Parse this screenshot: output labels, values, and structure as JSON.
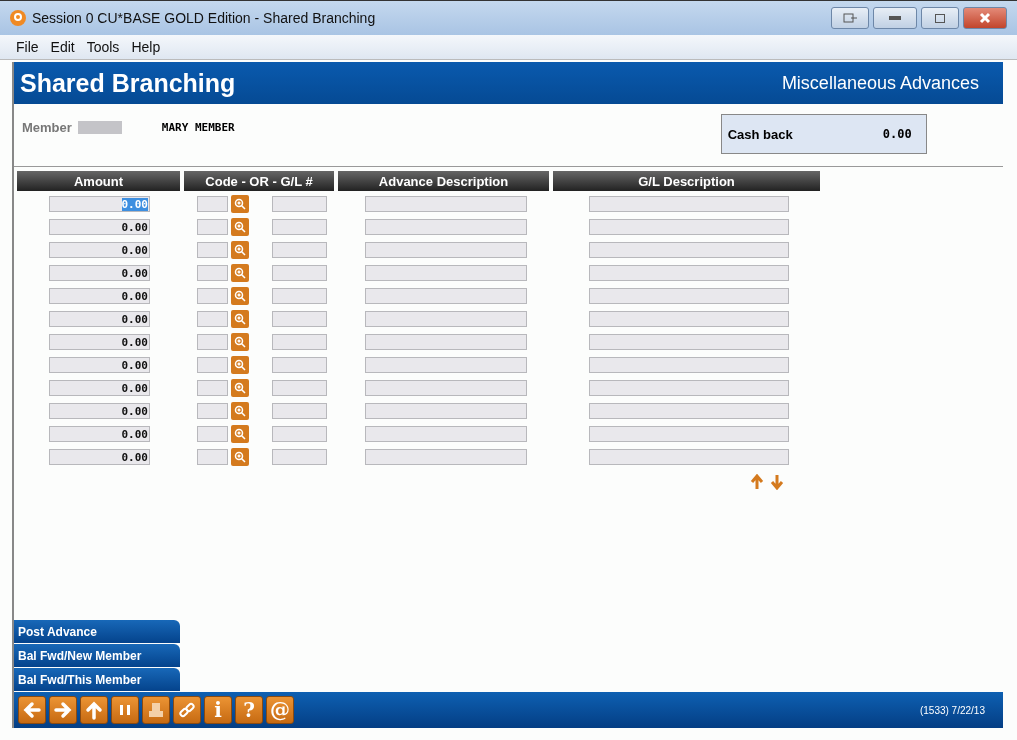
{
  "window": {
    "title": "Session 0 CU*BASE GOLD Edition - Shared Branching"
  },
  "menu": [
    "File",
    "Edit",
    "Tools",
    "Help"
  ],
  "header": {
    "title": "Shared Branching",
    "subtitle": "Miscellaneous Advances"
  },
  "member": {
    "label": "Member",
    "name": "MARY MEMBER"
  },
  "cash_back": {
    "label": "Cash back",
    "value": "0.00"
  },
  "table": {
    "columns": [
      "Amount",
      "Code - OR - G/L #",
      "Advance Description",
      "G/L Description"
    ],
    "rows": [
      {
        "amount": "0.00",
        "selected": true
      },
      {
        "amount": "0.00",
        "selected": false
      },
      {
        "amount": "0.00",
        "selected": false
      },
      {
        "amount": "0.00",
        "selected": false
      },
      {
        "amount": "0.00",
        "selected": false
      },
      {
        "amount": "0.00",
        "selected": false
      },
      {
        "amount": "0.00",
        "selected": false
      },
      {
        "amount": "0.00",
        "selected": false
      },
      {
        "amount": "0.00",
        "selected": false
      },
      {
        "amount": "0.00",
        "selected": false
      },
      {
        "amount": "0.00",
        "selected": false
      },
      {
        "amount": "0.00",
        "selected": false
      }
    ]
  },
  "actions": [
    "Post Advance",
    "Bal Fwd/New Member",
    "Bal Fwd/This Member"
  ],
  "toolbar": [
    {
      "kind": "back"
    },
    {
      "kind": "forward"
    },
    {
      "kind": "up"
    },
    {
      "kind": "pause"
    },
    {
      "kind": "print"
    },
    {
      "kind": "link"
    },
    {
      "kind": "info",
      "glyph": "i"
    },
    {
      "kind": "help",
      "glyph": "?"
    },
    {
      "kind": "email",
      "glyph": "@"
    }
  ],
  "status": "(1533) 7/22/13"
}
